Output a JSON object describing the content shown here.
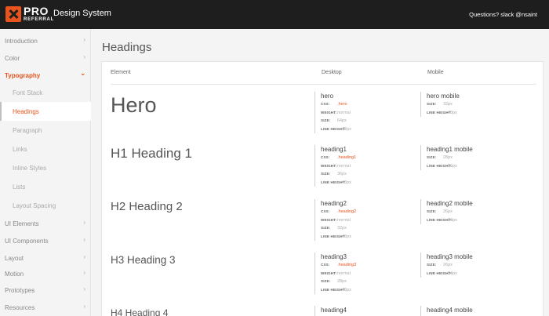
{
  "header": {
    "logo_pro": "PRO",
    "logo_referral": "REFERRAL",
    "app_title": "Design System",
    "help_text": "Questions? slack @nsaint"
  },
  "colors": {
    "accent": "#e8541e",
    "topbar": "#1e1e1e"
  },
  "sidebar": {
    "items": [
      {
        "label": "Introduction",
        "icon": "chevron-right-icon"
      },
      {
        "label": "Color",
        "icon": "chevron-right-icon"
      },
      {
        "label": "Typography",
        "icon": "chevron-down-icon",
        "expanded": true
      },
      {
        "label": "UI Elements",
        "icon": "chevron-right-icon"
      },
      {
        "label": "UI Components",
        "icon": "chevron-right-icon"
      },
      {
        "label": "Layout",
        "icon": "chevron-right-icon"
      },
      {
        "label": "Motion",
        "icon": "chevron-right-icon"
      },
      {
        "label": "Prototypes",
        "icon": "chevron-right-icon"
      },
      {
        "label": "Resources",
        "icon": "chevron-right-icon"
      }
    ],
    "typography_sub": [
      "Font Stack",
      "Headings",
      "Paragraph",
      "Links",
      "Inline Styles",
      "Lists",
      "Layout Spacing"
    ],
    "selected_sub": "Headings"
  },
  "main": {
    "title": "Headings",
    "columns": [
      "Element",
      "Desktop",
      "Mobile"
    ],
    "keys": {
      "css": "CSS:",
      "weight": "WEIGHT:",
      "size": "SIZE:",
      "line_height": "LINE HEIGHT:"
    },
    "rows": [
      {
        "element": "Hero",
        "desktop": {
          "name": "hero",
          "css": ".hero",
          "weight": "normal",
          "size": "64px",
          "line_height": "72px"
        },
        "mobile": {
          "name": "hero mobile",
          "size": "32px",
          "line_height": "40px"
        }
      },
      {
        "element": "H1 Heading 1",
        "desktop": {
          "name": "heading1",
          "css": ".heading1",
          "weight": "normal",
          "size": "36px",
          "line_height": "40px"
        },
        "mobile": {
          "name": "heading1 mobile",
          "size": "28px",
          "line_height": "36px"
        }
      },
      {
        "element": "H2 Heading 2",
        "desktop": {
          "name": "heading2",
          "css": ".heading2",
          "weight": "normal",
          "size": "32px",
          "line_height": "40px"
        },
        "mobile": {
          "name": "heading2 mobile",
          "size": "26px",
          "line_height": "34px"
        }
      },
      {
        "element": "H3 Heading 3",
        "desktop": {
          "name": "heading3",
          "css": ".heading3",
          "weight": "normal",
          "size": "28px",
          "line_height": "40px"
        },
        "mobile": {
          "name": "heading3 mobile",
          "size": "26px",
          "line_height": "34px"
        }
      },
      {
        "element": "H4 Heading 4",
        "desktop": {
          "name": "heading4"
        },
        "mobile": {
          "name": "heading4 mobile"
        }
      }
    ]
  }
}
